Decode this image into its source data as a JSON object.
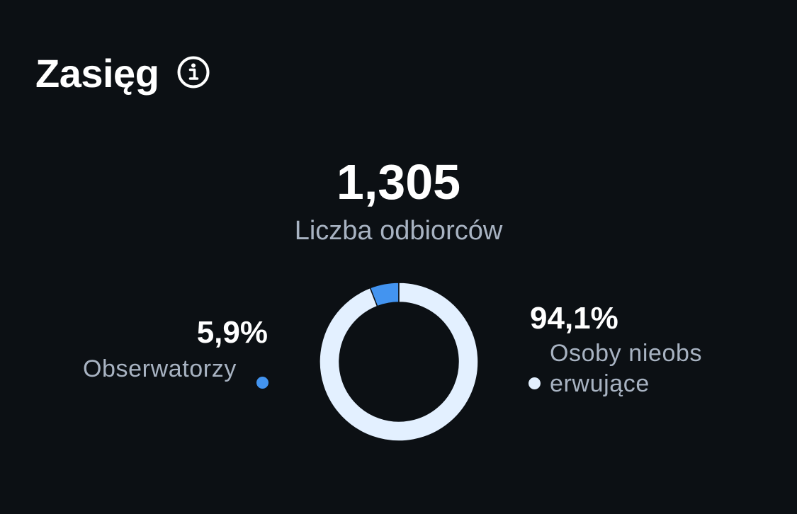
{
  "header": {
    "title": "Zasięg",
    "info_icon": "info-icon"
  },
  "summary": {
    "total": "1,305",
    "total_label": "Liczba odbiorców"
  },
  "colors": {
    "background": "#0c1014",
    "followers": "#4394f0",
    "non_followers": "#e3f0ff",
    "muted_text": "#a8b3c2"
  },
  "legend": {
    "followers": {
      "pct": "5,9%",
      "label": "Obserwatorzy"
    },
    "non_followers": {
      "pct": "94,1%",
      "label": "Osoby nieobserwujące"
    }
  },
  "chart_data": {
    "type": "pie",
    "categories": [
      "Obserwatorzy",
      "Osoby nieobserwujące"
    ],
    "values": [
      5.9,
      94.1
    ]
  }
}
